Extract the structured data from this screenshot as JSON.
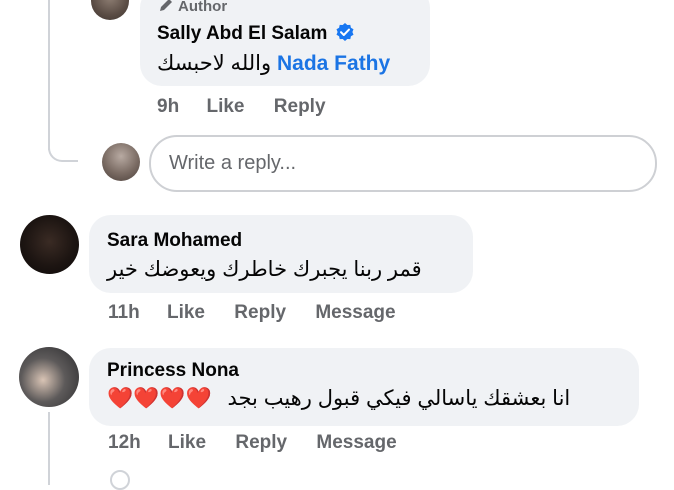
{
  "comments": [
    {
      "badge": "Author",
      "author": "Sally Abd El Salam",
      "verified": true,
      "mention": "Nada Fathy",
      "text": "والله لاحبسك",
      "time": "9h",
      "actions": [
        "Like",
        "Reply"
      ]
    },
    {
      "author": "Sara Mohamed",
      "text": "قمر ربنا يجبرك خاطرك ويعوضك خير",
      "time": "11h",
      "actions": [
        "Like",
        "Reply",
        "Message"
      ]
    },
    {
      "author": "Princess Nona",
      "text": "انا بعشقك ياسالي فيكي قبول رهيب بجد",
      "emoji": "❤️❤️❤️❤️",
      "time": "12h",
      "actions": [
        "Like",
        "Reply",
        "Message"
      ]
    }
  ],
  "reply_box": {
    "placeholder": "Write a reply..."
  },
  "colors": {
    "bubble": "#f0f2f5",
    "mention": "#1b74e4",
    "meta": "#65676b",
    "verified": "#1877f2",
    "heart": "#e0191b"
  },
  "icons": [
    "pencil-icon",
    "verified-badge-icon",
    "heart-emoji"
  ]
}
